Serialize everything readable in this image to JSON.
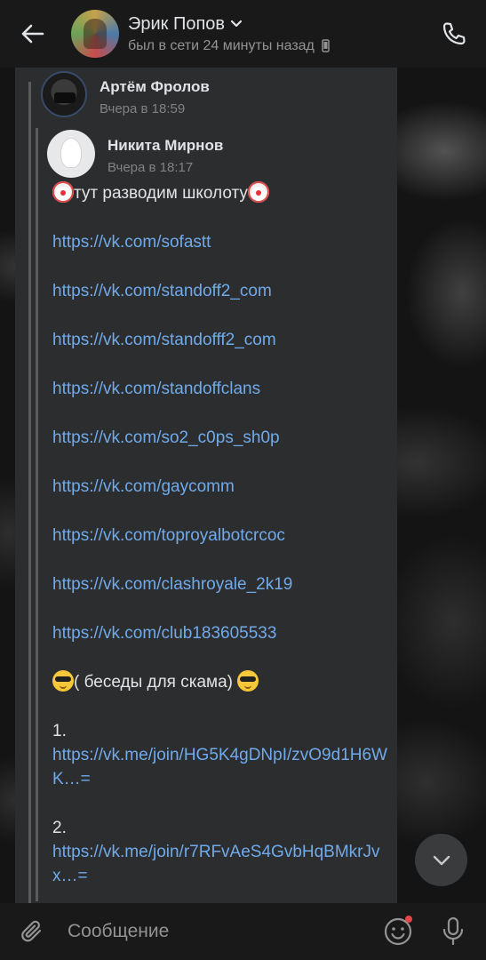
{
  "header": {
    "chat_name": "Эрик Попов",
    "status": "был в сети 24 минуты назад",
    "icons": {
      "back": "arrow-left-icon",
      "dropdown": "chevron-down-icon",
      "device": "phone-device-icon",
      "call": "phone-call-icon"
    }
  },
  "forwarded": {
    "outer_author": {
      "name": "Артём Фролов",
      "time": "Вчера в 18:59"
    },
    "inner_author": {
      "name": "Никита Мирнов",
      "time": "Вчера в 18:17"
    },
    "intro_text": "тут разводим школоту",
    "links": [
      "https://vk.com/sofastt",
      "https://vk.com/standoff2_com",
      "https://vk.com/standofff2_com",
      "https://vk.com/standoffclans",
      "https://vk.com/so2_c0ps_sh0p",
      "https://vk.com/gaycomm",
      "https://vk.com/toproyalbotcrcoc",
      "https://vk.com/clashroyale_2k19",
      "https://vk.com/club183605533"
    ],
    "section_text": "( беседы для скама)",
    "join_items": [
      {
        "number": "1.",
        "link": "https://vk.me/join/HG5K4gDNpI/zvO9d1H6WK…="
      },
      {
        "number": "2.",
        "link": "https://vk.me/join/r7RFvAeS4GvbHqBMkrJvx…="
      }
    ]
  },
  "composer": {
    "placeholder": "Сообщение",
    "value": ""
  },
  "colors": {
    "header_bg": "#19191a",
    "card_bg": "#2c2d2e",
    "link": "#71aaeb",
    "text": "#e1e3e6",
    "muted": "#939393",
    "notification_dot": "#e64646"
  }
}
